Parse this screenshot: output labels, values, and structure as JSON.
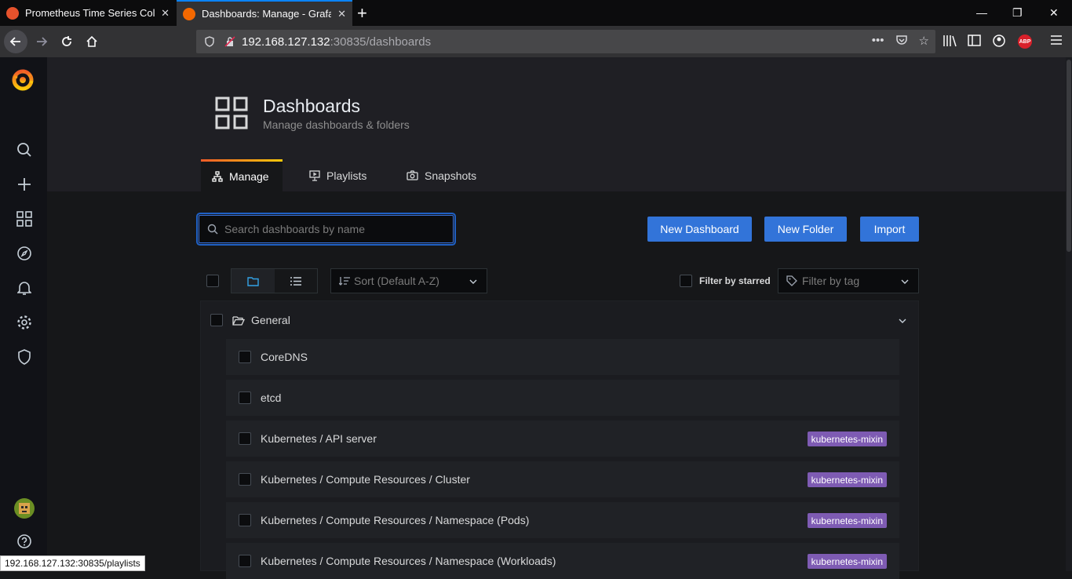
{
  "browser": {
    "tabs": [
      {
        "title": "Prometheus Time Series Coll",
        "active": false
      },
      {
        "title": "Dashboards: Manage - Grafa",
        "active": true
      }
    ],
    "url_host": "192.168.127.132",
    "url_rest": ":30835/dashboards",
    "status_url": "192.168.127.132:30835/playlists",
    "abp_label": "ABP"
  },
  "page": {
    "title": "Dashboards",
    "subtitle": "Manage dashboards & folders"
  },
  "tabs": [
    {
      "label": "Manage",
      "active": true
    },
    {
      "label": "Playlists",
      "active": false
    },
    {
      "label": "Snapshots",
      "active": false
    }
  ],
  "search": {
    "placeholder": "Search dashboards by name"
  },
  "buttons": {
    "new_dashboard": "New Dashboard",
    "new_folder": "New Folder",
    "import": "Import"
  },
  "filters": {
    "sort": "Sort (Default A-Z)",
    "starred": "Filter by starred",
    "tag": "Filter by tag"
  },
  "folder": {
    "name": "General",
    "dashboards": [
      {
        "name": "CoreDNS",
        "tag": ""
      },
      {
        "name": "etcd",
        "tag": ""
      },
      {
        "name": "Kubernetes / API server",
        "tag": "kubernetes-mixin"
      },
      {
        "name": "Kubernetes / Compute Resources / Cluster",
        "tag": "kubernetes-mixin"
      },
      {
        "name": "Kubernetes / Compute Resources / Namespace (Pods)",
        "tag": "kubernetes-mixin"
      },
      {
        "name": "Kubernetes / Compute Resources / Namespace (Workloads)",
        "tag": "kubernetes-mixin"
      }
    ]
  },
  "colors": {
    "primary_button": "#3274d9",
    "tag": "#7e5bb3",
    "accent_gradient_start": "#f05a28",
    "accent_gradient_end": "#fbca0a"
  }
}
